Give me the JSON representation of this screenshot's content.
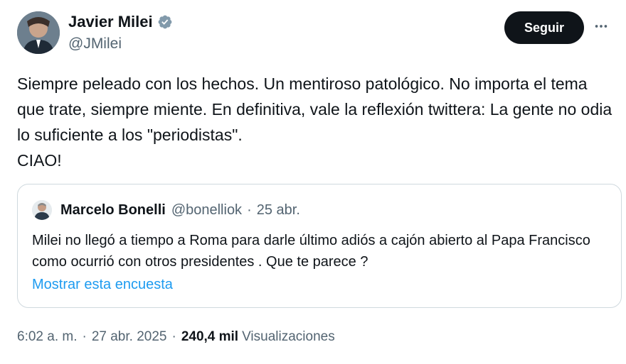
{
  "author": {
    "name": "Javier Milei",
    "handle": "@JMilei",
    "verified": true,
    "avatar_icon": "user-avatar-icon"
  },
  "actions": {
    "follow_label": "Seguir",
    "more_icon": "more-horizontal-icon"
  },
  "tweet": {
    "text": "Siempre peleado con los hechos. Un mentiroso patológico. No importa el tema que trate, siempre miente. En definitiva, vale la reflexión twittera: La gente no odia lo suficiente a los \"periodistas\".\nCIAO!"
  },
  "quoted": {
    "name": "Marcelo Bonelli",
    "handle": "@bonelliok",
    "separator": "·",
    "date": "25 abr.",
    "text": "Milei no llegó a tiempo a Roma para darle último adiós a cajón abierto al Papa Francisco como ocurrió con otros presidentes . Que te parece ?",
    "link_label": "Mostrar esta encuesta"
  },
  "meta": {
    "time": "6:02 a. m.",
    "separator": "·",
    "date": "27 abr. 2025",
    "views_count": "240,4 mil",
    "views_label": "Visualizaciones"
  },
  "colors": {
    "text": "#0f1419",
    "secondary": "#536471",
    "link": "#1d9bf0",
    "border": "#cfd9de",
    "verified_badge": "#829aab"
  }
}
